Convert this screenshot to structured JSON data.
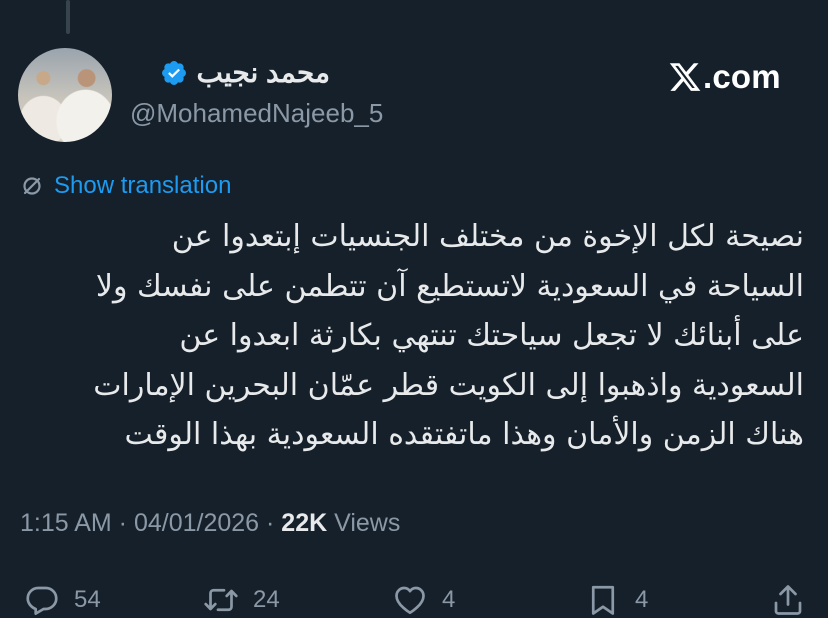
{
  "brand": {
    "logo_text": ".com"
  },
  "author": {
    "display_name": "محمد نجيب",
    "handle": "@MohamedNajeeb_5",
    "verified": true
  },
  "translation": {
    "label": "Show translation"
  },
  "tweet": {
    "lines": [
      "نصيحة لكل الإخوة من مختلف الجنسيات إبتعدوا عن",
      "السياحة في السعودية لاتستطيع آن تتطمن على نفسك ولا",
      "على أبنائك لا تجعل سياحتك تنتهي بكارثة ابعدوا عن",
      "السعودية واذهبوا إلى الكويت قطر عمّان البحرين الإمارات",
      "هناك الزمن والأمان وهذا ماتفتقده السعودية بهذا الوقت"
    ]
  },
  "meta": {
    "time": "1:15 AM",
    "separator": " · ",
    "date": "04/01/2026",
    "views_count": "22K",
    "views_label": " Views"
  },
  "actions": {
    "replies": "54",
    "retweets": "24",
    "likes": "4",
    "bookmarks": "4"
  },
  "colors": {
    "background": "#15202b",
    "text": "#e7e9ea",
    "secondary": "#8b98a5",
    "accent": "#1d9bf0"
  },
  "icons": [
    "x-logo-icon",
    "verified-badge-icon",
    "translate-icon",
    "reply-icon",
    "retweet-icon",
    "like-icon",
    "bookmark-icon",
    "share-icon"
  ]
}
